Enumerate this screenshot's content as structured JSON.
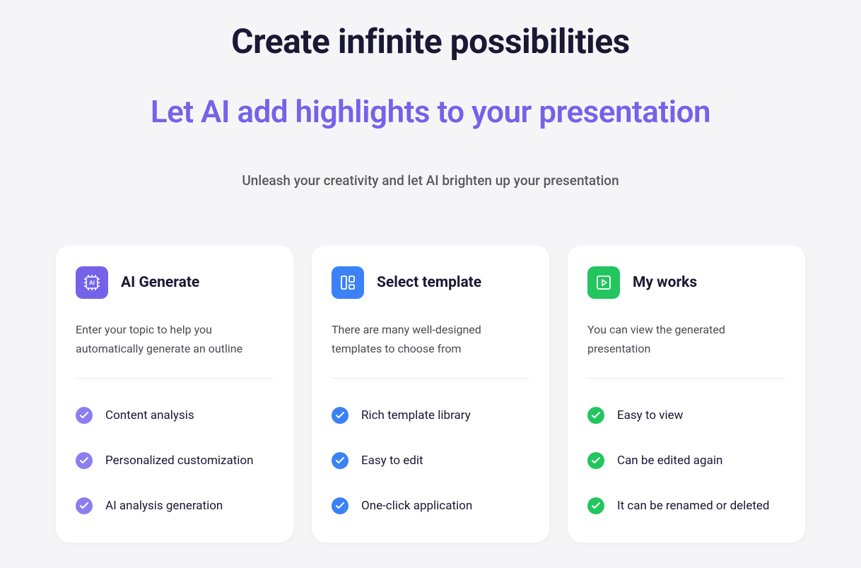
{
  "title_main": "Create infinite possibilities",
  "title_sub": "Let AI add highlights to your presentation",
  "tagline": "Unleash your creativity and let AI brighten up your presentation",
  "cards": [
    {
      "icon_color": "purple",
      "title": "AI Generate",
      "description": "Enter your topic to help you automatically generate an outline",
      "features": [
        "Content analysis",
        "Personalized customization",
        "AI analysis generation"
      ]
    },
    {
      "icon_color": "blue",
      "title": "Select template",
      "description": "There are many well-designed templates to choose from",
      "features": [
        "Rich template library",
        "Easy to edit",
        "One-click application"
      ]
    },
    {
      "icon_color": "green",
      "title": "My works",
      "description": "You can view the generated presentation",
      "features": [
        "Easy to view",
        "Can be edited again",
        "It can be renamed or deleted"
      ]
    }
  ]
}
